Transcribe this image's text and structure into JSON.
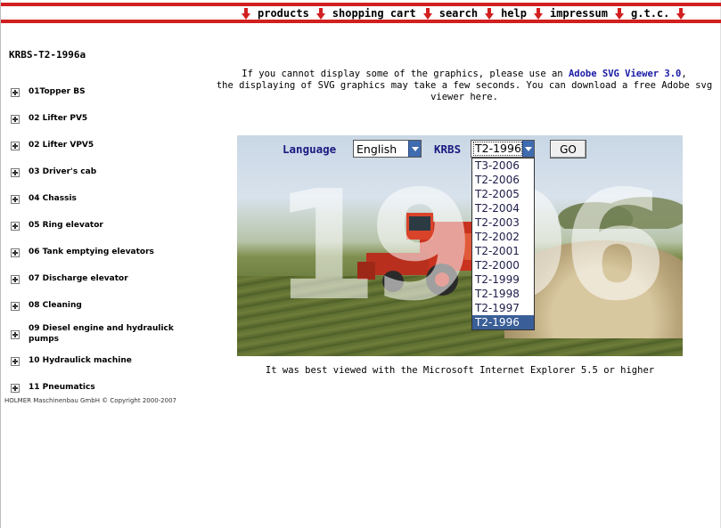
{
  "nav": {
    "items": [
      "products",
      "shopping cart",
      "search",
      "help",
      "impressum",
      "g.t.c."
    ]
  },
  "sidebar": {
    "title": "KRBS-T2-1996a",
    "items": [
      "01Topper BS",
      "02 Lifter PV5",
      "02 Lifter VPV5",
      "03 Driver's cab",
      "04 Chassis",
      "05 Ring elevator",
      "06 Tank emptying elevators",
      "07 Discharge elevator",
      "08 Cleaning",
      "09 Diesel engine and hydraulick pumps",
      "10 Hydraulick machine",
      "11 Pneumatics"
    ],
    "copyright": "HOLMER Maschinenbau GmbH © Copyright 2000-2007"
  },
  "info": {
    "line1_pre": "If you cannot display some of the graphics, please use an ",
    "line1_link": "Adobe SVG Viewer 3.0",
    "line1_post": ",",
    "line2": "the displaying of SVG graphics may take a few seconds. You can download a free Adobe svg viewer here."
  },
  "controls": {
    "language_label": "Language",
    "language_value": "English",
    "krbs_label": "KRBS",
    "krbs_value": "T2-1996",
    "go_label": "GO"
  },
  "hero": {
    "year_text": "1996"
  },
  "dropdown": {
    "options": [
      "T3-2006",
      "T2-2006",
      "T2-2005",
      "T2-2004",
      "T2-2003",
      "T2-2002",
      "T2-2001",
      "T2-2000",
      "T2-1999",
      "T2-1998",
      "T2-1997",
      "T2-1996"
    ],
    "selected": "T2-1996"
  },
  "footer_note": "It was best viewed with the Microsoft Internet Explorer 5.5 or higher",
  "colors": {
    "nav_red": "#d21f1f",
    "label_blue": "#1a1a80",
    "link_blue": "#1a1aa6",
    "selected_option": "#3a5f98"
  }
}
